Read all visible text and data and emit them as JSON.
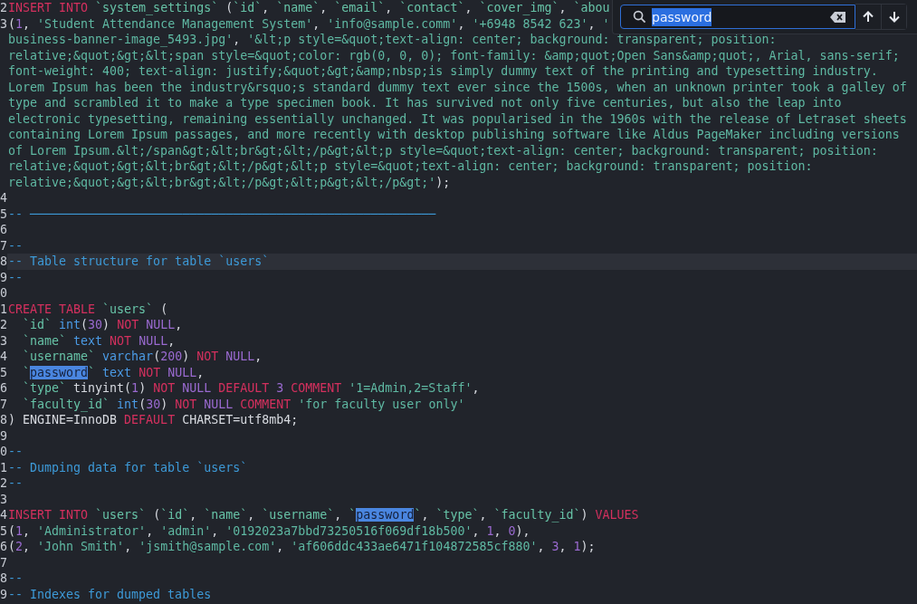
{
  "editor": {
    "lines": [
      {
        "number": "2",
        "current": false,
        "tokens": [
          {
            "kind": "keyword",
            "text": "INSERT INTO "
          },
          {
            "kind": "name",
            "text": "`system_settings`"
          },
          {
            "kind": "plain",
            "text": " ("
          },
          {
            "kind": "name",
            "text": "`id`"
          },
          {
            "kind": "plain",
            "text": ", "
          },
          {
            "kind": "name",
            "text": "`name`"
          },
          {
            "kind": "plain",
            "text": ", "
          },
          {
            "kind": "name",
            "text": "`email`"
          },
          {
            "kind": "plain",
            "text": ", "
          },
          {
            "kind": "name",
            "text": "`contact`"
          },
          {
            "kind": "plain",
            "text": ", "
          },
          {
            "kind": "name",
            "text": "`cover_img`"
          },
          {
            "kind": "plain",
            "text": ", "
          },
          {
            "kind": "name",
            "text": "`abou"
          }
        ]
      },
      {
        "number": "3",
        "current": false,
        "tokens": [
          {
            "kind": "plain",
            "text": "("
          },
          {
            "kind": "number",
            "text": "1"
          },
          {
            "kind": "plain",
            "text": ", "
          },
          {
            "kind": "string",
            "text": "'Student Attendance Management System'"
          },
          {
            "kind": "plain",
            "text": ", "
          },
          {
            "kind": "string",
            "text": "'info@sample.comm'"
          },
          {
            "kind": "plain",
            "text": ", "
          },
          {
            "kind": "string",
            "text": "'+6948 8542 623'"
          },
          {
            "kind": "plain",
            "text": ", "
          },
          {
            "kind": "string",
            "text": "'"
          }
        ]
      },
      {
        "current": false,
        "tokens": [
          {
            "kind": "string",
            "text": "business-banner-image_5493.jpg'"
          },
          {
            "kind": "plain",
            "text": ", "
          },
          {
            "kind": "string",
            "text": "'&lt;p style=&quot;text-align: center; background: transparent; position:"
          }
        ]
      },
      {
        "current": false,
        "tokens": [
          {
            "kind": "string",
            "text": "relative;&quot;&gt;&lt;span style=&quot;color: rgb(0, 0, 0); font-family: &amp;quot;Open Sans&amp;quot;, Arial, sans-serif;"
          }
        ]
      },
      {
        "current": false,
        "tokens": [
          {
            "kind": "string",
            "text": "font-weight: 400; text-align: justify;&quot;&gt;&amp;nbsp;is simply dummy text of the printing and typesetting industry."
          }
        ]
      },
      {
        "current": false,
        "tokens": [
          {
            "kind": "string",
            "text": "Lorem Ipsum has been the industry&rsquo;s standard dummy text ever since the 1500s, when an unknown printer took a galley of"
          }
        ]
      },
      {
        "current": false,
        "tokens": [
          {
            "kind": "string",
            "text": "type and scrambled it to make a type specimen book. It has survived not only five centuries, but also the leap into"
          }
        ]
      },
      {
        "current": false,
        "tokens": [
          {
            "kind": "string",
            "text": "electronic typesetting, remaining essentially unchanged. It was popularised in the 1960s with the release of Letraset sheets"
          }
        ]
      },
      {
        "current": false,
        "tokens": [
          {
            "kind": "string",
            "text": "containing Lorem Ipsum passages, and more recently with desktop publishing software like Aldus PageMaker including versions"
          }
        ]
      },
      {
        "current": false,
        "tokens": [
          {
            "kind": "string",
            "text": "of Lorem Ipsum.&lt;/span&gt;&lt;br&gt;&lt;/p&gt;&lt;p style=&quot;text-align: center; background: transparent; position:"
          }
        ]
      },
      {
        "current": false,
        "tokens": [
          {
            "kind": "string",
            "text": "relative;&quot;&gt;&lt;br&gt;&lt;/p&gt;&lt;p style=&quot;text-align: center; background: transparent; position:"
          }
        ]
      },
      {
        "current": false,
        "tokens": [
          {
            "kind": "string",
            "text": "relative;&quot;&gt;&lt;br&gt;&lt;/p&gt;&lt;p&gt;&lt;/p&gt;'"
          },
          {
            "kind": "plain",
            "text": ");"
          }
        ]
      },
      {
        "number": "4",
        "current": false
      },
      {
        "number": "5",
        "current": false,
        "tokens": [
          {
            "kind": "comment",
            "text": "-- ────────────────────────────────────────────────────────"
          }
        ]
      },
      {
        "number": "6",
        "current": false
      },
      {
        "number": "7",
        "current": false,
        "tokens": [
          {
            "kind": "comment",
            "text": "--"
          }
        ]
      },
      {
        "number": "8",
        "current": true,
        "tokens": [
          {
            "kind": "comment",
            "text": "-- Table structure for table `users`"
          }
        ]
      },
      {
        "number": "9",
        "current": false,
        "tokens": [
          {
            "kind": "comment",
            "text": "--"
          }
        ]
      },
      {
        "number": "0",
        "current": false
      },
      {
        "number": "1",
        "current": false,
        "tokens": [
          {
            "kind": "keyword",
            "text": "CREATE TABLE "
          },
          {
            "kind": "name",
            "text": "`users`"
          },
          {
            "kind": "plain",
            "text": " ("
          }
        ]
      },
      {
        "number": "2",
        "current": false,
        "tokens": [
          {
            "kind": "name",
            "text": "  `id` "
          },
          {
            "kind": "type",
            "text": "int"
          },
          {
            "kind": "plain",
            "text": "("
          },
          {
            "kind": "number",
            "text": "30"
          },
          {
            "kind": "plain",
            "text": ") "
          },
          {
            "kind": "keyword",
            "text": "NOT "
          },
          {
            "kind": "constant",
            "text": "NULL"
          },
          {
            "kind": "plain",
            "text": ","
          }
        ]
      },
      {
        "number": "3",
        "current": false,
        "tokens": [
          {
            "kind": "name",
            "text": "  `name` "
          },
          {
            "kind": "type",
            "text": "text "
          },
          {
            "kind": "keyword",
            "text": "NOT "
          },
          {
            "kind": "constant",
            "text": "NULL"
          },
          {
            "kind": "plain",
            "text": ","
          }
        ]
      },
      {
        "number": "4",
        "current": false,
        "tokens": [
          {
            "kind": "name",
            "text": "  `username` "
          },
          {
            "kind": "type",
            "text": "varchar"
          },
          {
            "kind": "plain",
            "text": "("
          },
          {
            "kind": "number",
            "text": "200"
          },
          {
            "kind": "plain",
            "text": ") "
          },
          {
            "kind": "keyword",
            "text": "NOT "
          },
          {
            "kind": "constant",
            "text": "NULL"
          },
          {
            "kind": "plain",
            "text": ","
          }
        ]
      },
      {
        "number": "5",
        "current": false,
        "tokens": [
          {
            "kind": "name",
            "text": "  `"
          },
          {
            "kind": "match",
            "text": "password"
          },
          {
            "kind": "name",
            "text": "` "
          },
          {
            "kind": "type",
            "text": "text "
          },
          {
            "kind": "keyword",
            "text": "NOT "
          },
          {
            "kind": "constant",
            "text": "NULL"
          },
          {
            "kind": "plain",
            "text": ","
          }
        ]
      },
      {
        "number": "6",
        "current": false,
        "tokens": [
          {
            "kind": "name",
            "text": "  `type`"
          },
          {
            "kind": "plain",
            "text": " tinyint("
          },
          {
            "kind": "number",
            "text": "1"
          },
          {
            "kind": "plain",
            "text": ") "
          },
          {
            "kind": "keyword",
            "text": "NOT "
          },
          {
            "kind": "constant",
            "text": "NULL "
          },
          {
            "kind": "keyword",
            "text": "DEFAULT "
          },
          {
            "kind": "number",
            "text": "3 "
          },
          {
            "kind": "keyword",
            "text": "COMMENT "
          },
          {
            "kind": "string",
            "text": "'1=Admin,2=Staff'"
          },
          {
            "kind": "plain",
            "text": ","
          }
        ]
      },
      {
        "number": "7",
        "current": false,
        "tokens": [
          {
            "kind": "name",
            "text": "  `faculty_id` "
          },
          {
            "kind": "type",
            "text": "int"
          },
          {
            "kind": "plain",
            "text": "("
          },
          {
            "kind": "number",
            "text": "30"
          },
          {
            "kind": "plain",
            "text": ") "
          },
          {
            "kind": "keyword",
            "text": "NOT "
          },
          {
            "kind": "constant",
            "text": "NULL "
          },
          {
            "kind": "keyword",
            "text": "COMMENT "
          },
          {
            "kind": "string",
            "text": "'for faculty user only'"
          }
        ]
      },
      {
        "number": "8",
        "current": false,
        "tokens": [
          {
            "kind": "plain",
            "text": ") ENGINE=InnoDB "
          },
          {
            "kind": "keyword",
            "text": "DEFAULT "
          },
          {
            "kind": "plain",
            "text": "CHARSET=utf8mb4;"
          }
        ]
      },
      {
        "number": "9",
        "current": false
      },
      {
        "number": "0",
        "current": false,
        "tokens": [
          {
            "kind": "comment",
            "text": "--"
          }
        ]
      },
      {
        "number": "1",
        "current": false,
        "tokens": [
          {
            "kind": "comment",
            "text": "-- Dumping data for table `users`"
          }
        ]
      },
      {
        "number": "2",
        "current": false,
        "tokens": [
          {
            "kind": "comment",
            "text": "--"
          }
        ]
      },
      {
        "number": "3",
        "current": false
      },
      {
        "number": "4",
        "current": false,
        "tokens": [
          {
            "kind": "keyword",
            "text": "INSERT INTO "
          },
          {
            "kind": "name",
            "text": "`users`"
          },
          {
            "kind": "plain",
            "text": " ("
          },
          {
            "kind": "name",
            "text": "`id`"
          },
          {
            "kind": "plain",
            "text": ", "
          },
          {
            "kind": "name",
            "text": "`name`"
          },
          {
            "kind": "plain",
            "text": ", "
          },
          {
            "kind": "name",
            "text": "`username`"
          },
          {
            "kind": "plain",
            "text": ", "
          },
          {
            "kind": "name",
            "text": "`"
          },
          {
            "kind": "match",
            "text": "password"
          },
          {
            "kind": "name",
            "text": "`"
          },
          {
            "kind": "plain",
            "text": ", "
          },
          {
            "kind": "name",
            "text": "`type`"
          },
          {
            "kind": "plain",
            "text": ", "
          },
          {
            "kind": "name",
            "text": "`faculty_id`"
          },
          {
            "kind": "plain",
            "text": ") "
          },
          {
            "kind": "keyword",
            "text": "VALUES"
          }
        ]
      },
      {
        "number": "5",
        "current": false,
        "tokens": [
          {
            "kind": "plain",
            "text": "("
          },
          {
            "kind": "number",
            "text": "1"
          },
          {
            "kind": "plain",
            "text": ", "
          },
          {
            "kind": "string",
            "text": "'Administrator'"
          },
          {
            "kind": "plain",
            "text": ", "
          },
          {
            "kind": "string",
            "text": "'admin'"
          },
          {
            "kind": "plain",
            "text": ", "
          },
          {
            "kind": "string",
            "text": "'0192023a7bbd73250516f069df18b500'"
          },
          {
            "kind": "plain",
            "text": ", "
          },
          {
            "kind": "number",
            "text": "1"
          },
          {
            "kind": "plain",
            "text": ", "
          },
          {
            "kind": "number",
            "text": "0"
          },
          {
            "kind": "plain",
            "text": "),"
          }
        ]
      },
      {
        "number": "6",
        "current": false,
        "tokens": [
          {
            "kind": "plain",
            "text": "("
          },
          {
            "kind": "number",
            "text": "2"
          },
          {
            "kind": "plain",
            "text": ", "
          },
          {
            "kind": "string",
            "text": "'John Smith'"
          },
          {
            "kind": "plain",
            "text": ", "
          },
          {
            "kind": "string",
            "text": "'jsmith@sample.com'"
          },
          {
            "kind": "plain",
            "text": ", "
          },
          {
            "kind": "string",
            "text": "'af606ddc433ae6471f104872585cf880'"
          },
          {
            "kind": "plain",
            "text": ", "
          },
          {
            "kind": "number",
            "text": "3"
          },
          {
            "kind": "plain",
            "text": ", "
          },
          {
            "kind": "number",
            "text": "1"
          },
          {
            "kind": "plain",
            "text": ");"
          }
        ]
      },
      {
        "number": "7",
        "current": false
      },
      {
        "number": "8",
        "current": false,
        "tokens": [
          {
            "kind": "comment",
            "text": "--"
          }
        ]
      },
      {
        "number": "9",
        "current": false,
        "tokens": [
          {
            "kind": "comment",
            "text": "-- Indexes for dumped tables"
          }
        ]
      }
    ]
  },
  "search": {
    "value": "password"
  }
}
